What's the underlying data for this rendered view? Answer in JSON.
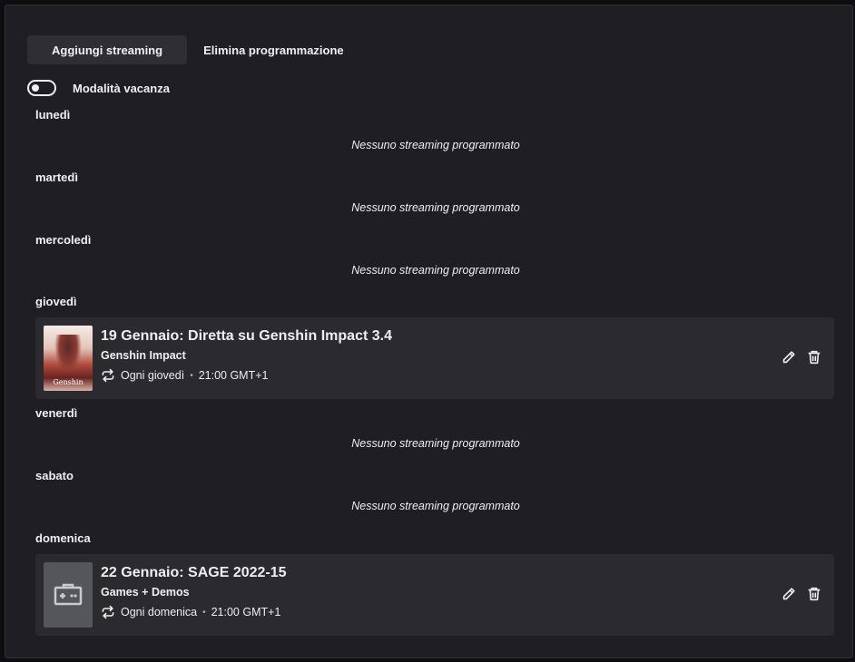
{
  "tabs": {
    "add_streaming": "Aggiungi streaming",
    "delete_schedule": "Elimina programmazione"
  },
  "vacation": {
    "label": "Modalità vacanza",
    "enabled": false
  },
  "empty_text": "Nessuno streaming programmato",
  "days": {
    "monday": "lunedì",
    "tuesday": "martedì",
    "wednesday": "mercoledì",
    "thursday": "giovedì",
    "friday": "venerdì",
    "saturday": "sabato",
    "sunday": "domenica"
  },
  "empty_messages": {
    "monday": "Nessuno streaming programmato",
    "tuesday": "Nessuno streaming programmato",
    "wednesday": "Nessuno streaming programmato",
    "friday": "Nessuno streaming programmato",
    "saturday": "Nessuno streaming programmato"
  },
  "streams": {
    "thursday": {
      "title": "19 Gennaio: Diretta su Genshin Impact 3.4",
      "category": "Genshin Impact",
      "recurrence": "Ogni giovedì",
      "separator": "•",
      "time": "21:00 GMT+1",
      "thumb_text": "Genshin"
    },
    "sunday": {
      "title": "22 Gennaio: SAGE 2022-15",
      "category": "Games + Demos",
      "recurrence": "Ogni domenica",
      "separator": "•",
      "time": "21:00 GMT+1"
    }
  },
  "colors": {
    "background": "#1f1f23",
    "card": "#2a2a2f",
    "text": "#efeff1",
    "tab_active": "#2e2e33"
  }
}
